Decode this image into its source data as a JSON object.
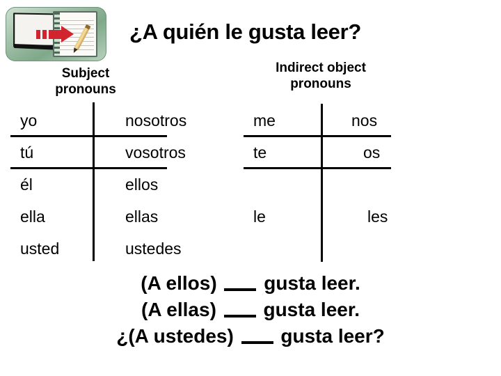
{
  "slide": {
    "title": "¿A quién le gusta leer?"
  },
  "logo": {
    "name": "board-to-notebook-logo",
    "parts": [
      "whiteboard",
      "red-arrow",
      "notepad",
      "pencil"
    ],
    "plate_color": "#9dbda4",
    "arrow_color": "#d1242f"
  },
  "subject_table": {
    "header_line1": "Subject",
    "header_line2": "pronouns",
    "rows": [
      {
        "singular": "yo",
        "plural": "nosotros"
      },
      {
        "singular": "tú",
        "plural": "vosotros"
      },
      {
        "singular": "él",
        "plural": "ellos"
      },
      {
        "singular": "ella",
        "plural": "ellas"
      },
      {
        "singular": "usted",
        "plural": "ustedes"
      }
    ]
  },
  "indirect_object_table": {
    "header_line1": "Indirect object",
    "header_line2": "pronouns",
    "rows": [
      {
        "singular": "me",
        "plural": "nos"
      },
      {
        "singular": "te",
        "plural": "os"
      },
      {
        "singular": "le",
        "plural": "les"
      }
    ]
  },
  "practice": {
    "sentences": [
      {
        "before": "(A ellos)",
        "after": "gusta leer."
      },
      {
        "before": "(A ellas)",
        "after": "gusta leer."
      },
      {
        "before": "¿(A ustedes)",
        "after": "gusta leer?"
      }
    ]
  }
}
